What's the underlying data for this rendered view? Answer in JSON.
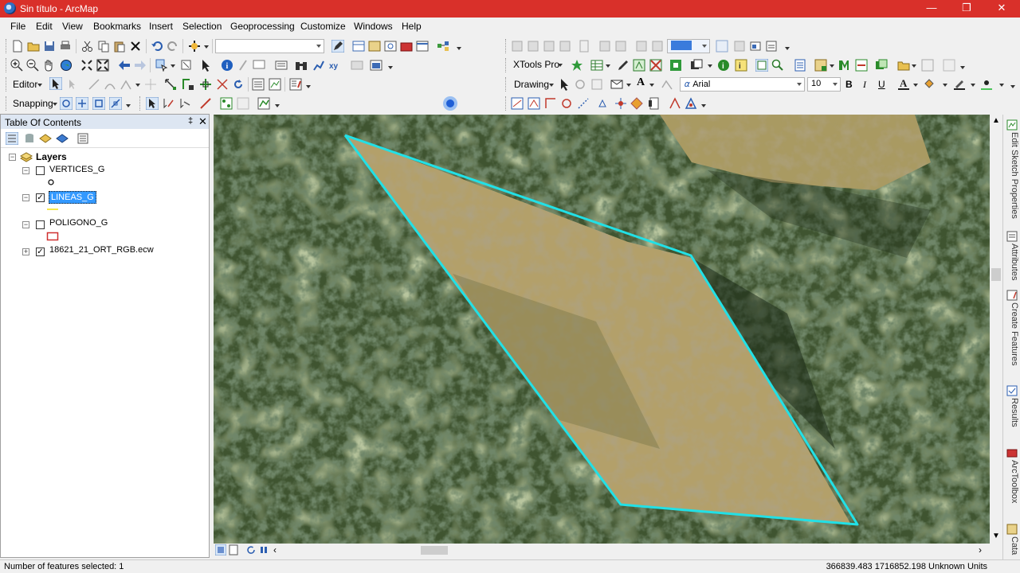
{
  "window": {
    "title": "Sin título - ArcMap",
    "minimize": "—",
    "maximize": "❐",
    "close": "✕"
  },
  "menu": [
    "File",
    "Edit",
    "View",
    "Bookmarks",
    "Insert",
    "Selection",
    "Geoprocessing",
    "Customize",
    "Windows",
    "Help"
  ],
  "toolbars": {
    "scale_value": "",
    "xtools_label": "XTools Pro",
    "drawing_label": "Drawing",
    "editor_label": "Editor",
    "snapping_label": "Snapping",
    "font_name": "Arial",
    "font_size": "10",
    "bold": "B",
    "italic": "I",
    "underline": "U",
    "text_tool": "A"
  },
  "toc": {
    "title": "Table Of Contents",
    "pin": "‡",
    "close": "✕",
    "root_label": "Layers",
    "layers": [
      {
        "name": "VERTICES_G",
        "checked": false,
        "expanded": true,
        "symbol": "point"
      },
      {
        "name": "LINEAS_G",
        "checked": true,
        "expanded": true,
        "symbol": "line",
        "selected": true
      },
      {
        "name": "POLIGONO_G",
        "checked": false,
        "expanded": true,
        "symbol": "polygon"
      },
      {
        "name": "18621_21_ORT_RGB.ecw",
        "checked": true,
        "expanded": false,
        "symbol": "raster"
      }
    ]
  },
  "dock_tabs": [
    "Edit Sketch Properties",
    "Attributes",
    "Create Features",
    "Results",
    "ArcToolbox",
    "Cata"
  ],
  "status": {
    "selected": "Number of features selected: 1",
    "coords": "366839.483  1716852.198 Unknown Units"
  },
  "colors": {
    "titlebar": "#d9302a",
    "selection_line": "#22e0e6",
    "toc_selected": "#3399ff"
  }
}
